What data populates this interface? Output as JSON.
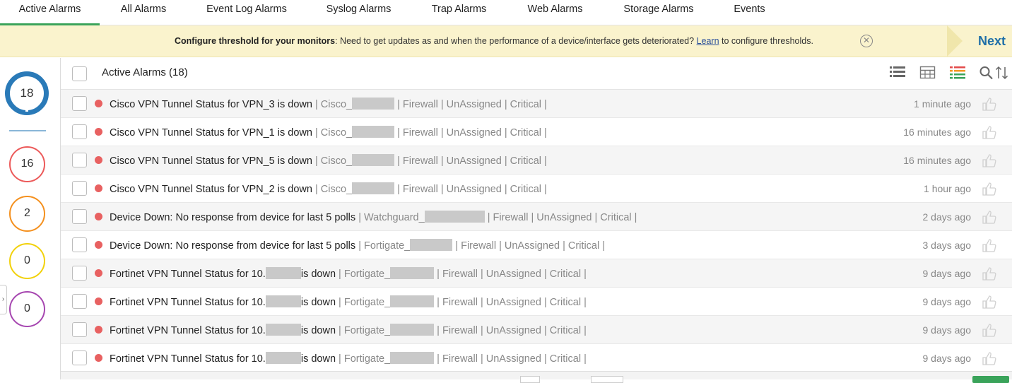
{
  "tabs": [
    {
      "label": "Active Alarms",
      "active": true
    },
    {
      "label": "All Alarms"
    },
    {
      "label": "Event Log Alarms"
    },
    {
      "label": "Syslog Alarms"
    },
    {
      "label": "Trap Alarms"
    },
    {
      "label": "Web Alarms"
    },
    {
      "label": "Storage Alarms"
    },
    {
      "label": "Events"
    }
  ],
  "banner": {
    "bold": "Configure threshold for your monitors",
    "text1": ": Need to get updates as and when the performance of a device/interface gets deteriorated? ",
    "link": "Learn",
    "text2": " to configure thresholds.",
    "close": "✕",
    "next": "Next"
  },
  "summary": {
    "total": "18",
    "severities": [
      {
        "count": "16",
        "color": "#ec5a5a"
      },
      {
        "count": "2",
        "color": "#f4901e"
      },
      {
        "count": "0",
        "color": "#f2d10a"
      },
      {
        "count": "0",
        "color": "#a646b0"
      }
    ]
  },
  "list": {
    "title": "Active Alarms (18)",
    "icons": [
      "list-view-icon",
      "grid-view-icon",
      "colored-list-icon",
      "search-icon",
      "sort-icon"
    ]
  },
  "alarms": [
    {
      "title": "Cisco VPN Tunnel Status for VPN_3 is down",
      "device": "Cisco_",
      "meta": "| Firewall | UnAssigned | Critical |",
      "time": "1 minute ago"
    },
    {
      "title": "Cisco VPN Tunnel Status for VPN_1 is down",
      "device": "Cisco_",
      "meta": "| Firewall | UnAssigned | Critical |",
      "time": "16 minutes ago"
    },
    {
      "title": "Cisco VPN Tunnel Status for VPN_5 is down",
      "device": "Cisco_",
      "meta": "| Firewall | UnAssigned | Critical |",
      "time": "16 minutes ago"
    },
    {
      "title": "Cisco VPN Tunnel Status for VPN_2 is down",
      "device": "Cisco_",
      "meta": "| Firewall | UnAssigned | Critical |",
      "time": "1 hour ago"
    },
    {
      "title": "Device Down: No response from device for last 5 polls",
      "device": "Watchguard_",
      "meta": "| Firewall | UnAssigned | Critical |",
      "time": "2 days ago"
    },
    {
      "title": "Device Down: No response from device for last 5 polls",
      "device": "Fortigate_",
      "meta": "| Firewall | UnAssigned | Critical |",
      "time": "3 days ago"
    },
    {
      "title": "Fortinet VPN Tunnel Status for 10.",
      "title_suffix": "is down",
      "device": "Fortigate_",
      "meta": "| Firewall | UnAssigned | Critical |",
      "time": "9 days ago"
    },
    {
      "title": "Fortinet VPN Tunnel Status for 10.",
      "title_suffix": "is down",
      "device": "Fortigate_",
      "meta": "| Firewall | UnAssigned | Critical |",
      "time": "9 days ago"
    },
    {
      "title": "Fortinet VPN Tunnel Status for 10.",
      "title_suffix": "is down",
      "device": "Fortigate_",
      "meta": "| Firewall | UnAssigned | Critical |",
      "time": "9 days ago"
    },
    {
      "title": "Fortinet VPN Tunnel Status for 10.",
      "title_suffix": "is down",
      "device": "Fortigate_",
      "meta": "| Firewall | UnAssigned | Critical |",
      "time": "9 days ago"
    }
  ]
}
